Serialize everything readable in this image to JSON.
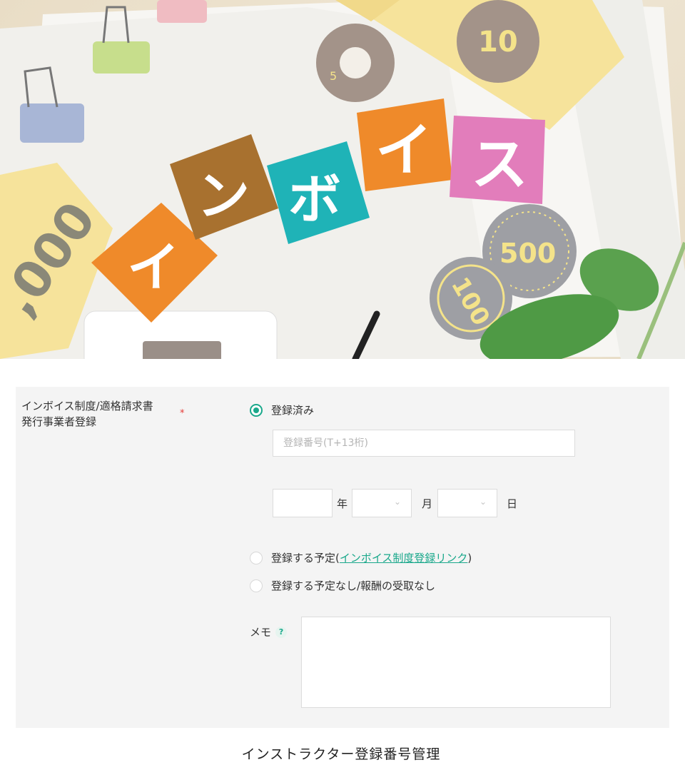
{
  "hero": {
    "block_chars": [
      "イ",
      "ン",
      "ボ",
      "イ",
      "ス"
    ],
    "coin_labels": [
      "10",
      "5",
      "500",
      "100"
    ],
    "bill_label": ",000",
    "colors": {
      "orange": "#ef8a2a",
      "wood": "#a8712f",
      "teal": "#1fb3b7",
      "pink": "#e27dbb",
      "yellow_bill": "#f6e39b",
      "grey_coin": "#9e9fa4",
      "leaf": "#4f9a45"
    }
  },
  "form": {
    "field_label_line1": "インボイス制度/適格請求書",
    "field_label_line2": "発行事業者登録",
    "required_mark": "*",
    "option_registered": "登録済み",
    "registration_placeholder": "登録番号(T+13桁)",
    "year_unit": "年",
    "month_unit": "月",
    "day_unit": "日",
    "option_planned_prefix": "登録する予定(",
    "option_planned_link": "インボイス制度登録リンク",
    "option_planned_suffix": ")",
    "option_not_planned": "登録する予定なし/報酬の受取なし",
    "memo_label": "メモ",
    "help_icon_text": "?",
    "accent_color": "#1aa88b"
  },
  "caption": "インストラクター登録番号管理"
}
